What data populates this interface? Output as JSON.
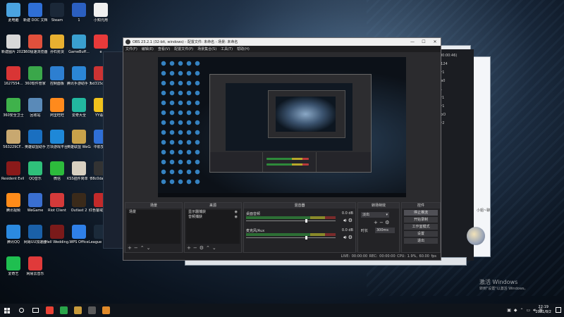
{
  "desktop_icons": [
    {
      "label": "此电脑",
      "color": "#4aa3e0"
    },
    {
      "label": "新建 DOC 文档",
      "color": "#2f6fd6"
    },
    {
      "label": "Steam",
      "color": "#1b2838"
    },
    {
      "label": "1",
      "color": "#2b5fc0"
    },
    {
      "label": "小知元用",
      "color": "#f0f0f0"
    },
    {
      "label": "新建图片 2021072...",
      "color": "#d8d8d8"
    },
    {
      "label": "360极速浏览器",
      "color": "#e0503c"
    },
    {
      "label": "孙石抢货",
      "color": "#e8b030"
    },
    {
      "label": "GameBuff...",
      "color": "#3aa0d0"
    },
    {
      "label": "e",
      "color": "#e83a3a"
    },
    {
      "label": "1627554...",
      "color": "#d93535"
    },
    {
      "label": "360软件管家",
      "color": "#3aa74a"
    },
    {
      "label": "控制面板",
      "color": "#2d7fd1"
    },
    {
      "label": "腾讯手游助手 开放平台",
      "color": "#2b86d6"
    },
    {
      "label": "bd315c60...",
      "color": "#cc3333"
    },
    {
      "label": "360安全卫士",
      "color": "#3fb24b"
    },
    {
      "label": "回收站",
      "color": "#5a8ab8"
    },
    {
      "label": "阿里旺旺",
      "color": "#ff8a1c"
    },
    {
      "label": "爱奇大全",
      "color": "#22b8a0"
    },
    {
      "label": "YY语音",
      "color": "#f0c21c"
    },
    {
      "label": "563229CF...",
      "color": "#c8a870"
    },
    {
      "label": "英雄联盟助手",
      "color": "#1a6fc0"
    },
    {
      "label": "方块游戏平台",
      "color": "#1e88d8"
    },
    {
      "label": "英雄联盟 WeGame版",
      "color": "#c8a24a"
    },
    {
      "label": "中影梦画",
      "color": "#2f6fd6"
    },
    {
      "label": "Resident Evil Village",
      "color": "#8a1a1a"
    },
    {
      "label": "QQ音乐",
      "color": "#2fc07a"
    },
    {
      "label": "微信",
      "color": "#2dbb3c"
    },
    {
      "label": "KSS插件简单 卡狗伸伸Pro",
      "color": "#d8d0c0"
    },
    {
      "label": "88c0da37...",
      "color": "#333333"
    },
    {
      "label": "腾讯视频",
      "color": "#ff8c1a"
    },
    {
      "label": "WeGame",
      "color": "#3a6fd0"
    },
    {
      "label": "Riot Client",
      "color": "#d43a3a"
    },
    {
      "label": "Outlast 2",
      "color": "#3a2a1a"
    },
    {
      "label": "红色警戒3 起义时刻",
      "color": "#c22a2a"
    },
    {
      "label": "腾讯QQ",
      "color": "#2b8ae0"
    },
    {
      "label": "网易UU加速器",
      "color": "#1a60a8"
    },
    {
      "label": "Hell Wedding...",
      "color": "#7a1a1a"
    },
    {
      "label": "WPS Office",
      "color": "#2f80e8"
    },
    {
      "label": "League of Legends",
      "color": "#1b2a3a"
    },
    {
      "label": "爱奇艺",
      "color": "#1fbf50"
    },
    {
      "label": "网易云音乐",
      "color": "#e03a3a"
    }
  ],
  "obs": {
    "title": "OBS 23.2.1 (32-bit, windows) - 配置文件: 未命名 - 场景: 未命名",
    "window_buttons": [
      "—",
      "☐",
      "✕"
    ],
    "menu": [
      "文件(F)",
      "编辑(E)",
      "查看(V)",
      "配置文件(P)",
      "场景集合(S)",
      "工具(T)",
      "帮助(H)"
    ],
    "docks": {
      "scenes": {
        "title": "场景",
        "items": [
          "场景"
        ]
      },
      "sources": {
        "title": "来源",
        "items": [
          "显示器捕获",
          "音频捕获"
        ]
      },
      "mixer": {
        "title": "混音器",
        "channels": [
          {
            "name": "桌面音频",
            "db": "0.0 dB",
            "level": 0.72
          },
          {
            "name": "麦克风/Aux",
            "db": "0.0 dB",
            "level": 0.72
          }
        ]
      },
      "transitions": {
        "title": "转场特效",
        "selected": "淡出",
        "duration_label": "时长",
        "duration_value": "300ms"
      },
      "controls": {
        "title": "控件",
        "buttons": [
          "停止推流",
          "开始录制",
          "工作室模式",
          "设置",
          "退出"
        ]
      }
    },
    "status_bar": "LIVE: 00:00:00   REC: 00:00:00   CPU: 1.9%, 60.00 fps"
  },
  "chat_lines": [
    "(00:00:46)",
    "0124",
    "",
    "dr1",
    "0a0",
    "",
    "r1",
    "kr1",
    "dr1",
    "0oO",
    "",
    "",
    "",
    "dr2"
  ],
  "chat_aside": "小姐~聊",
  "activation": {
    "title": "激活 Windows",
    "sub": "转到\"设置\"以激活 Windows。"
  },
  "taskbar": {
    "apps": [
      {
        "name": "chrome",
        "color": "#e94235"
      },
      {
        "name": "phone",
        "color": "#2aa54a"
      },
      {
        "name": "lol",
        "color": "#c89b3c"
      },
      {
        "name": "obs",
        "color": "#5a5a5a"
      },
      {
        "name": "game",
        "color": "#e08a2a"
      }
    ],
    "time": "22:19",
    "date": "2021/8/2"
  }
}
